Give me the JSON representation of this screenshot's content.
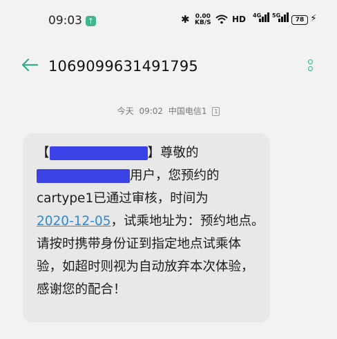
{
  "status_bar": {
    "time": "09:03",
    "net_speed_value": "0.00",
    "net_speed_unit": "KB/S",
    "hd": "HD",
    "sim1_label": "4G",
    "sim2_label": "5G",
    "battery": "78"
  },
  "header": {
    "sender_number": "1069099631491795"
  },
  "meta": {
    "day": "今天",
    "time": "09:02",
    "carrier": "中国电信1",
    "sim_slot": "1"
  },
  "message": {
    "bracket_open": "【",
    "bracket_close": "】尊敬的",
    "after_redact2": "用户，您预约的",
    "line3": "cartype1已通过审核，时间为",
    "date": "2020-12-05",
    "after_date": "，试乘地址为：预约地点。请按时携带身份证到指定地点试乘体验，如超时则视为自动放弃本次体验，感谢您的配合！"
  },
  "colors": {
    "accent": "#2fae8a",
    "link": "#2a8ad4",
    "redaction": "#3b42e6",
    "bubble": "#e8e8e8",
    "background": "#f2f2f2"
  }
}
